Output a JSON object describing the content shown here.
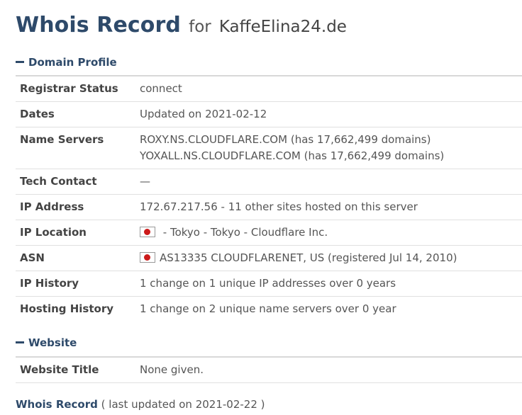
{
  "header": {
    "title_main": "Whois Record",
    "title_for": "for",
    "domain": "KaffeElina24.de"
  },
  "sections": {
    "domain_profile": {
      "heading": "Domain Profile"
    },
    "website": {
      "heading": "Website"
    }
  },
  "domain_profile": {
    "registrar_status": {
      "label": "Registrar Status",
      "value": "connect"
    },
    "dates": {
      "label": "Dates",
      "value": "Updated on 2021-02-12"
    },
    "name_servers": {
      "label": "Name Servers",
      "ns1": "ROXY.NS.CLOUDFLARE.COM",
      "ns1_note": "(has 17,662,499 domains)",
      "ns2": "YOXALL.NS.CLOUDFLARE.COM",
      "ns2_note": "(has 17,662,499 domains)"
    },
    "tech_contact": {
      "label": "Tech Contact",
      "value": "—"
    },
    "ip_address": {
      "label": "IP Address",
      "value": "172.67.217.56 - 11 other sites hosted on this server"
    },
    "ip_location": {
      "label": "IP Location",
      "value": " - Tokyo - Tokyo - Cloudflare Inc.",
      "flag_icon": "japan-flag-icon"
    },
    "asn": {
      "label": "ASN",
      "value": "AS13335 CLOUDFLARENET, US (registered Jul 14, 2010)",
      "flag_icon": "japan-flag-icon"
    },
    "ip_history": {
      "label": "IP History",
      "value": "1 change on 1 unique IP addresses over 0 years"
    },
    "hosting_history": {
      "label": "Hosting History",
      "value": "1 change on 2 unique name servers over 0 year"
    }
  },
  "website": {
    "website_title": {
      "label": "Website Title",
      "value": "None given."
    }
  },
  "footer": {
    "link": "Whois Record",
    "note": "( last updated on 2021-02-22 )"
  },
  "colors": {
    "heading": "#2e4a6a",
    "text": "#555555",
    "flag_red": "#cc1a1a"
  }
}
